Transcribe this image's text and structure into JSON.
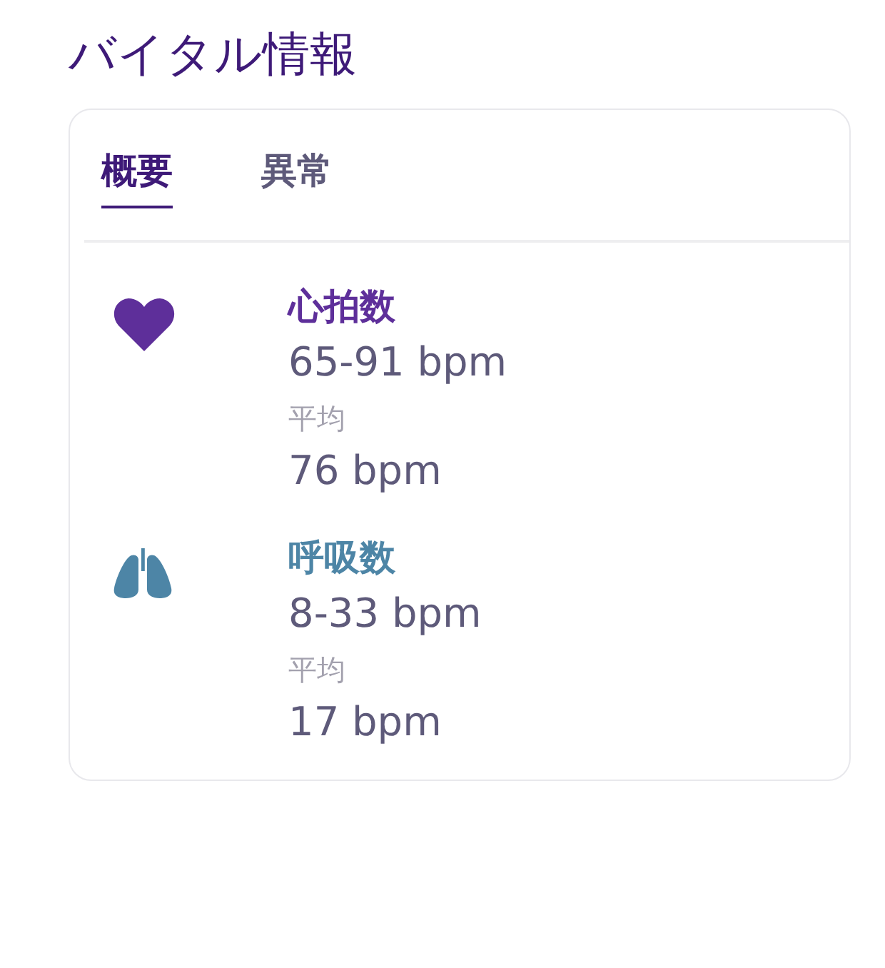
{
  "title": "バイタル情報",
  "tabs": [
    {
      "label": "概要",
      "selected": true
    },
    {
      "label": "異常",
      "selected": false
    }
  ],
  "vitals": [
    {
      "kind": "heart",
      "color": "#5e2f9a",
      "name": "心拍数",
      "range": "65-91 bpm",
      "average_label": "平均",
      "average": "76 bpm"
    },
    {
      "kind": "lungs",
      "color": "#4d85a6",
      "name": "呼吸数",
      "range": "8-33 bpm",
      "average_label": "平均",
      "average": "17 bpm"
    }
  ]
}
